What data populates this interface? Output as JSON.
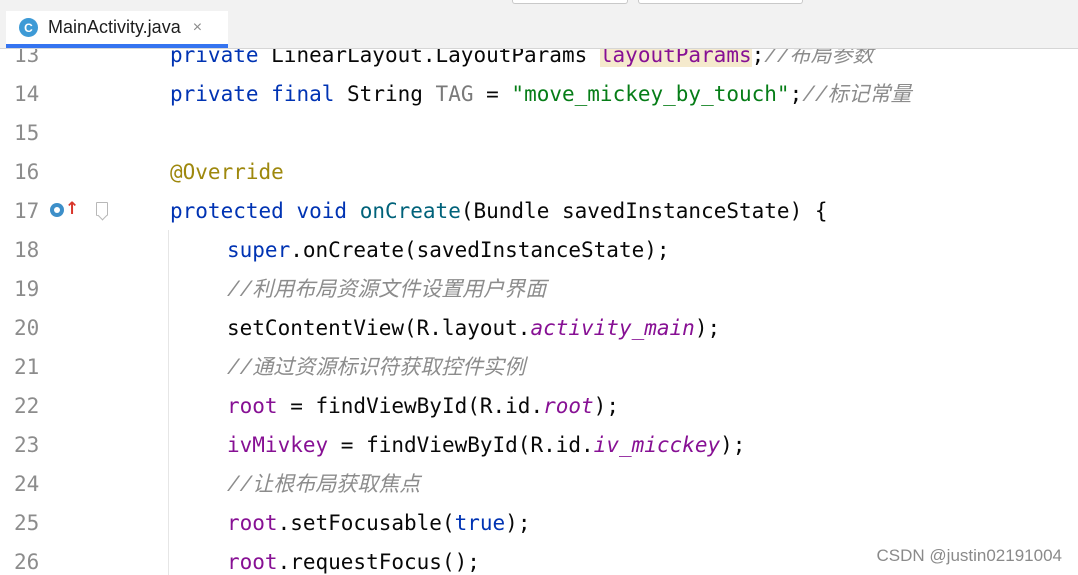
{
  "tab": {
    "icon_letter": "C",
    "title": "MainActivity.java",
    "close": "×"
  },
  "lines": [
    {
      "num": "13",
      "kw1": "private",
      "sp1": " LinearLayout.LayoutParams ",
      "hl": "layoutParams",
      "semi": ";",
      "comment": "//布局参数"
    },
    {
      "num": "14",
      "kw1": "private",
      "kw2": "final",
      "type": " String ",
      "grey": "TAG",
      "eq": " = ",
      "str": "\"move_mickey_by_touch\"",
      "semi": ";",
      "comment": "//标记常量"
    },
    {
      "num": "15"
    },
    {
      "num": "16",
      "ann": "@Override"
    },
    {
      "num": "17",
      "kw1": "protected",
      "kw2": "void",
      "method": "onCreate",
      "rest": "(Bundle savedInstanceState) {"
    },
    {
      "num": "18",
      "kw1": "super",
      "rest": ".onCreate(savedInstanceState);"
    },
    {
      "num": "19",
      "comment": "//利用布局资源文件设置用户界面"
    },
    {
      "num": "20",
      "pre": "setContentView(R.layout.",
      "fld": "activity_main",
      "post": ");"
    },
    {
      "num": "21",
      "comment": "//通过资源标识符获取控件实例"
    },
    {
      "num": "22",
      "var": "root",
      "pre": " = findViewById(R.id.",
      "fld": "root",
      "post": ");"
    },
    {
      "num": "23",
      "var": "ivMivkey",
      "pre": " = findViewById(R.id.",
      "fld": "iv_micckey",
      "post": ");"
    },
    {
      "num": "24",
      "comment": "//让根布局获取焦点"
    },
    {
      "num": "25",
      "var": "root",
      "pre": ".setFocusable(",
      "kw1": "true",
      "post": ");"
    },
    {
      "num": "26",
      "var": "root",
      "rest": ".requestFocus();"
    }
  ],
  "watermark": "CSDN @justin02191004",
  "colors": {
    "keyword": "#0033b3",
    "string": "#067d17",
    "comment": "#8c8c8c",
    "annotation": "#9e880d",
    "field": "#871094",
    "tab_accent": "#3574f0"
  }
}
